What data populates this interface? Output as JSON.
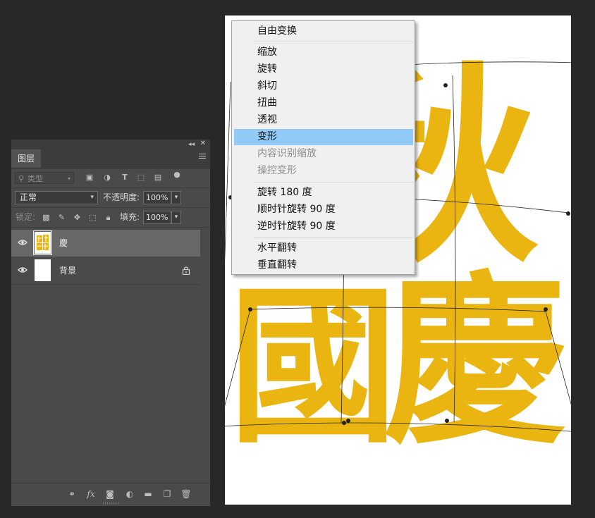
{
  "canvas": {
    "glyphs": [
      "秋",
      "國",
      "慶"
    ],
    "glyph_color": "#ebb511"
  },
  "layers_panel": {
    "tab_label": "图层",
    "filter_placeholder": "类型",
    "blend_mode": "正常",
    "opacity_label": "不透明度:",
    "opacity_value": "100%",
    "lock_label": "锁定:",
    "fill_label": "填充:",
    "fill_value": "100%",
    "layers": [
      {
        "name": "慶",
        "selected": true,
        "visible": true
      },
      {
        "name": "背景",
        "selected": false,
        "visible": true,
        "locked": true
      }
    ],
    "footer_icons": [
      "link-icon",
      "fx-icon",
      "mask-icon",
      "adjustment-icon",
      "folder-icon",
      "new-layer-icon",
      "trash-icon"
    ]
  },
  "context_menu": {
    "items": [
      {
        "label": "自由变换",
        "state": "normal"
      },
      {
        "label": "缩放",
        "state": "normal"
      },
      {
        "label": "旋转",
        "state": "normal"
      },
      {
        "label": "斜切",
        "state": "normal"
      },
      {
        "label": "扭曲",
        "state": "normal"
      },
      {
        "label": "透视",
        "state": "normal"
      },
      {
        "label": "变形",
        "state": "highlighted"
      },
      {
        "label": "内容识别缩放",
        "state": "disabled"
      },
      {
        "label": "操控变形",
        "state": "disabled"
      },
      {
        "label": "旋转 180 度",
        "state": "normal"
      },
      {
        "label": "顺时针旋转 90 度",
        "state": "normal"
      },
      {
        "label": "逆时针旋转 90 度",
        "state": "normal"
      },
      {
        "label": "水平翻转",
        "state": "normal"
      },
      {
        "label": "垂直翻转",
        "state": "normal"
      }
    ]
  },
  "colors": {
    "accent_highlight": "#91c9f7",
    "workspace_bg": "#282828",
    "panel_bg": "#4a4a4a"
  }
}
